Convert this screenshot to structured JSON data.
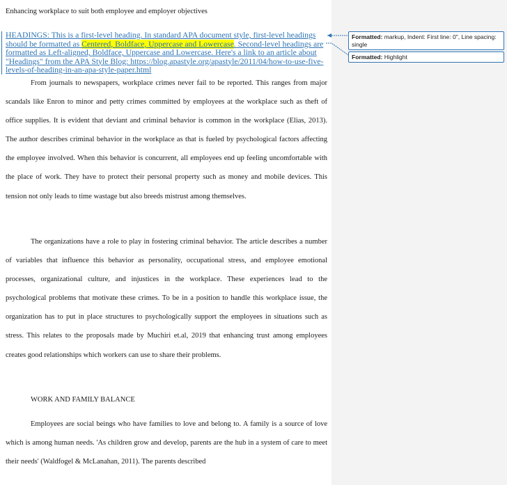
{
  "document": {
    "running_head": "Enhancing workplace to suit both employee and employer objectives",
    "tracked_note": {
      "part1": "HEADINGS: This is a first-level heading.  In standard APA document style, first-level headings should be formatted as ",
      "highlight": "Centered, Boldface, Uppercase and Lowercase",
      "part2": ".  Second-level headings are formatted as Left-aligned, Boldface, Uppercase and Lowercase.   Here's a link to an article about \"Headings\" from the APA Style Blog: https://blog.apastyle.org/apastyle/2011/04/how-to-use-five-levels-of-heading-in-an-apa-style-paper.html"
    },
    "paragraphs": [
      "From journals to newspapers, workplace crimes never fail to be reported. This ranges from major scandals like Enron to minor and petty crimes committed by employees at the workplace such as theft of office supplies. It is evident that deviant and criminal behavior is common in the workplace (Elias, 2013). The author describes criminal behavior in the workplace as that is fueled by psychological factors affecting the employee involved. When this behavior is concurrent, all employees end up feeling uncomfortable with the place of work. They have to protect their personal property such as money and mobile devices. This tension not only leads to time wastage but also breeds mistrust among themselves.",
      "The organizations have a role to play in fostering criminal behavior. The article describes a number of variables that influence this behavior as personality, occupational stress, and employee emotional processes, organizational culture, and injustices in the workplace. These experiences lead to the psychological problems that motivate these crimes. To be in a position to handle this workplace issue, the organization has to put in place structures to psychologically support the employees in situations such as stress. This relates to the proposals made by Muchiri et.al, 2019 that enhancing trust among employees creates good relationships which workers can use to share their problems.",
      "Employees are social beings who have families to love and belong to. A family is a source of love which is among human needs. 'As children grow and develop, parents are the hub in a system of care to meet their needs' (Waldfogel & McLanahan, 2011). The parents described"
    ],
    "section_heading": "WORK AND FAMILY BALANCE"
  },
  "comments": [
    {
      "label": "Formatted:",
      "text": " markup, Indent: First line:  0\", Line spacing:  single"
    },
    {
      "label": "Formatted:",
      "text": " Highlight"
    }
  ],
  "colors": {
    "markup_blue": "#2e74b5",
    "highlight": "#ffff00",
    "margin_bg": "#f3f3f3"
  }
}
